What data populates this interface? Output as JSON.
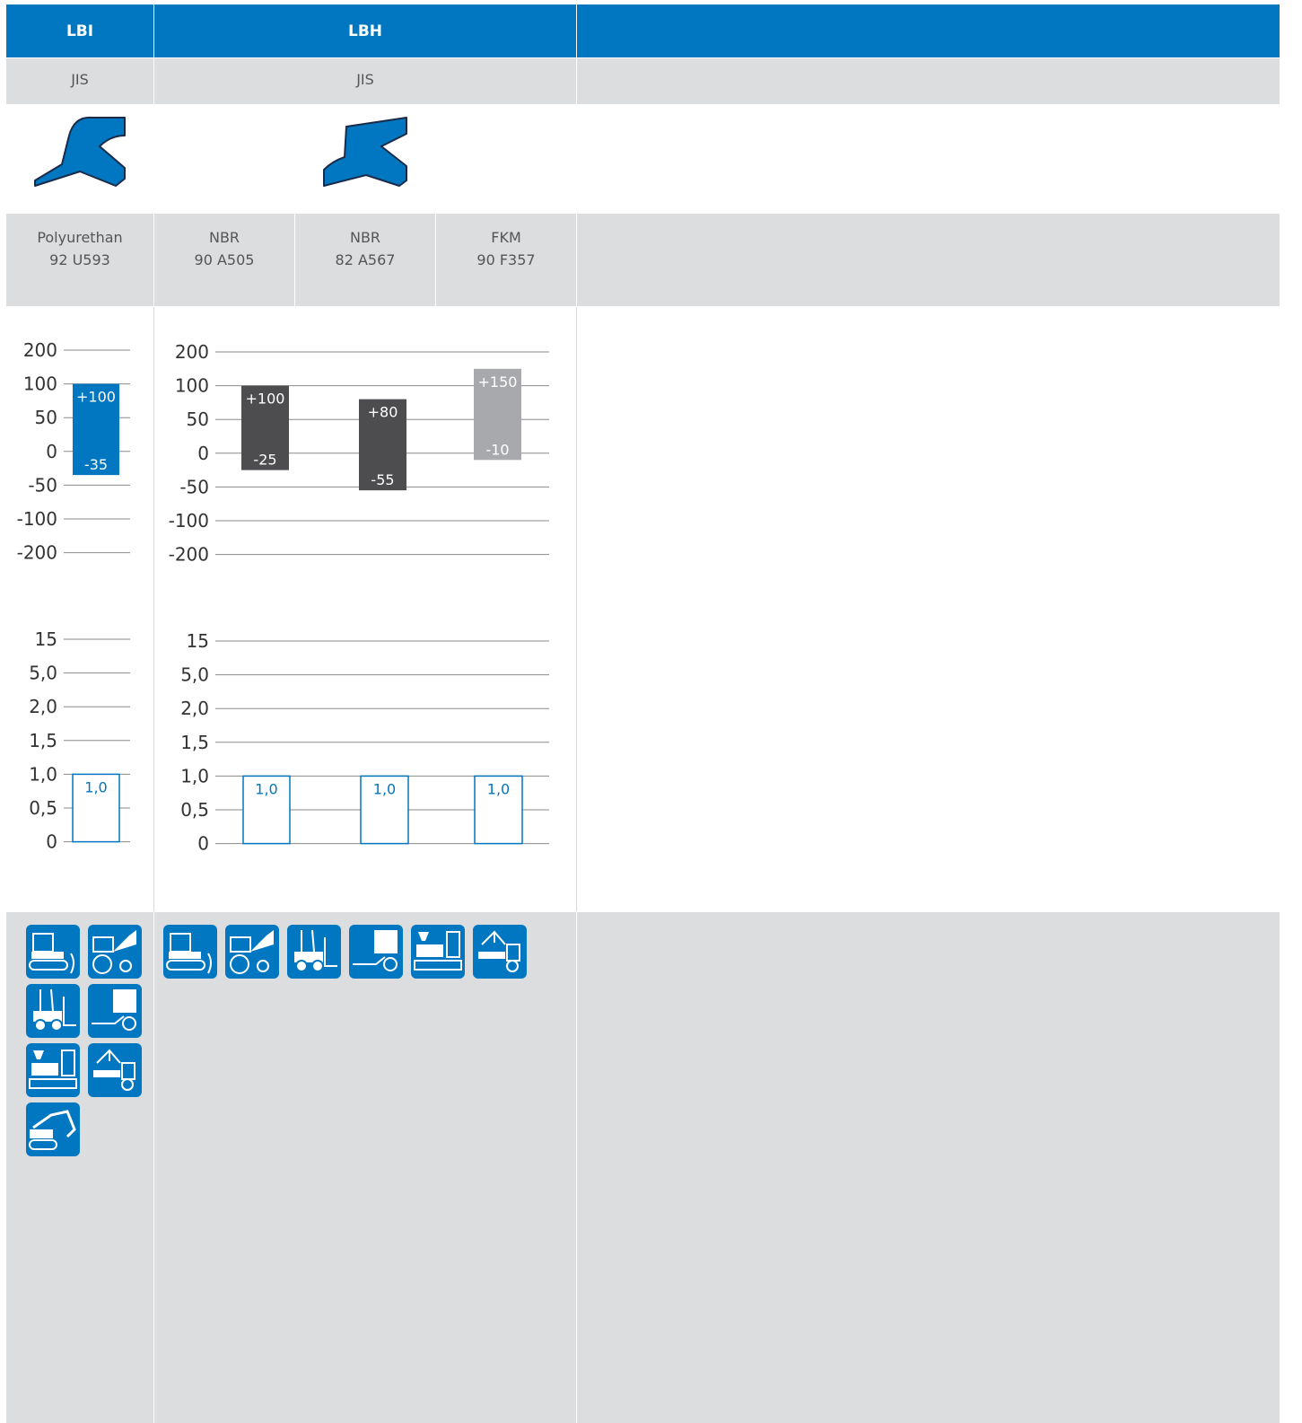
{
  "header": {
    "col1": "LBI",
    "col2": "LBH"
  },
  "standard": {
    "col1": "JIS",
    "col2": "JIS"
  },
  "materials": [
    {
      "name": "Polyurethan",
      "code": "92 U593"
    },
    {
      "name": "NBR",
      "code": "90 A505"
    },
    {
      "name": "NBR",
      "code": "82 A567"
    },
    {
      "name": "FKM",
      "code": "90 F357"
    }
  ],
  "icons": {
    "profile_lbi": "lip-seal-profile-icon",
    "profile_lbh": "lip-seal-profile-icon"
  },
  "colors": {
    "accent": "#0077c0",
    "dark_bar": "#4d4d4f",
    "light_bar": "#a7a9ac",
    "grey_bg": "#dcdddf"
  },
  "chart_data": [
    {
      "type": "bar",
      "chart_id": "temperature-lbi",
      "y_ticks": [
        "200",
        "100",
        "50",
        "0",
        "-50",
        "-100",
        "-200"
      ],
      "series": [
        {
          "material": "92 U593",
          "max": 100,
          "min": -35,
          "max_label": "+100",
          "min_label": "-35",
          "color": "#0077c0"
        }
      ]
    },
    {
      "type": "bar",
      "chart_id": "temperature-lbh",
      "y_ticks": [
        "200",
        "100",
        "50",
        "0",
        "-50",
        "-100",
        "-200"
      ],
      "series": [
        {
          "material": "90 A505",
          "max": 100,
          "min": -25,
          "max_label": "+100",
          "min_label": "-25",
          "color": "#4d4d4f"
        },
        {
          "material": "82 A567",
          "max": 80,
          "min": -55,
          "max_label": "+80",
          "min_label": "-55",
          "color": "#4d4d4f"
        },
        {
          "material": "90 F357",
          "max": 150,
          "min": -10,
          "max_label": "+150",
          "min_label": "-10",
          "color": "#a7a9ac"
        }
      ]
    },
    {
      "type": "bar",
      "chart_id": "speed-lbi",
      "y_ticks": [
        "15",
        "5,0",
        "2,0",
        "1,5",
        "1,0",
        "0,5",
        "0"
      ],
      "series": [
        {
          "material": "92 U593",
          "value": 1.0,
          "label": "1,0"
        }
      ]
    },
    {
      "type": "bar",
      "chart_id": "speed-lbh",
      "y_ticks": [
        "15",
        "5,0",
        "2,0",
        "1,5",
        "1,0",
        "0,5",
        "0"
      ],
      "series": [
        {
          "material": "90 A505",
          "value": 1.0,
          "label": "1,0"
        },
        {
          "material": "82 A567",
          "value": 1.0,
          "label": "1,0"
        },
        {
          "material": "90 F357",
          "value": 1.0,
          "label": "1,0"
        }
      ]
    }
  ],
  "applications": {
    "lbi": [
      "crawler-dozer-icon",
      "wheel-loader-icon",
      "forklift-icon",
      "agricultural-trailer-icon",
      "injection-moulding-machine-icon",
      "truck-crane-icon",
      "excavator-icon"
    ],
    "lbh": [
      "crawler-dozer-icon",
      "wheel-loader-icon",
      "forklift-icon",
      "agricultural-trailer-icon",
      "injection-moulding-machine-icon",
      "truck-crane-icon"
    ]
  }
}
